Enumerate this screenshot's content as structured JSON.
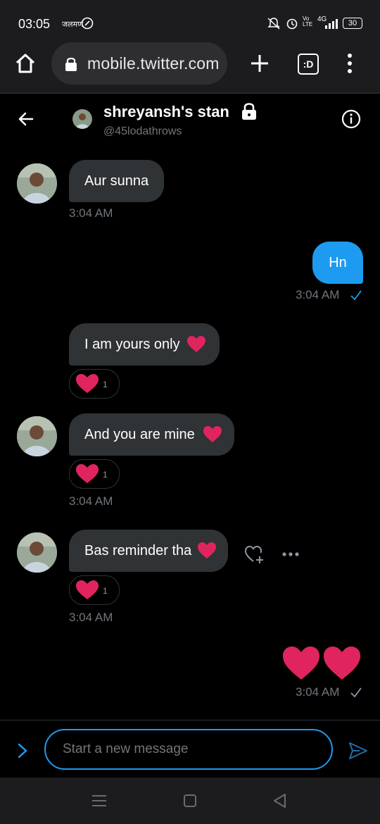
{
  "status": {
    "time": "03:05",
    "carrier_badge": "जलमण",
    "network": "4G",
    "volte": "Vo LTE",
    "battery": "30"
  },
  "browser": {
    "url": "mobile.twitter.com",
    "tab_label": ":D"
  },
  "conversation": {
    "title": "shreyansh's stan",
    "handle": "@45lodathrows"
  },
  "messages": [
    {
      "text": "Aur sunna",
      "time": "3:04 AM"
    },
    {
      "text": "Hn",
      "time": "3:04 AM"
    },
    {
      "text": "I am yours only",
      "reaction_count": "1"
    },
    {
      "text": "And you are mine",
      "reaction_count": "1",
      "time": "3:04 AM"
    },
    {
      "text": "Bas reminder tha",
      "reaction_count": "1",
      "time": "3:04 AM"
    },
    {
      "time": "3:04 AM"
    }
  ],
  "composer": {
    "placeholder": "Start a new message"
  },
  "colors": {
    "accent": "#1d9bf0",
    "heart": "#e0245e",
    "bubble_in": "#2f3336"
  }
}
